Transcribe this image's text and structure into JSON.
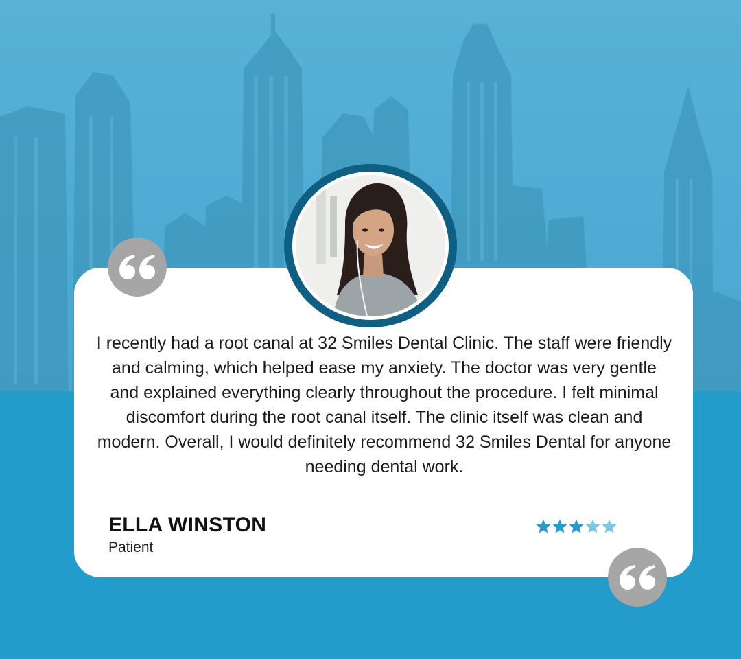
{
  "review": {
    "text": "I recently had a root canal at 32 Smiles Dental Clinic. The staff were friendly and calming, which helped ease my anxiety. The doctor was very gentle and explained everything clearly throughout the procedure. I felt minimal discomfort during the root canal itself. The clinic itself was clean and modern. Overall, I would definitely recommend 32 Smiles Dental for anyone needing dental work.",
    "reviewer_name": "ELLA WINSTON",
    "reviewer_role": "Patient",
    "rating": 3,
    "rating_max": 5
  },
  "colors": {
    "background": "#239ccc",
    "sky": "#58b2d7",
    "card": "#ffffff",
    "avatar_ring": "#0f5f82",
    "quote_badge": "#a6a6a6",
    "star_filled": "#2a9bc9",
    "star_empty": "#7cc6e3"
  },
  "icons": {
    "open_quote": "quote-open-icon",
    "close_quote": "quote-close-icon",
    "star": "star-icon"
  }
}
